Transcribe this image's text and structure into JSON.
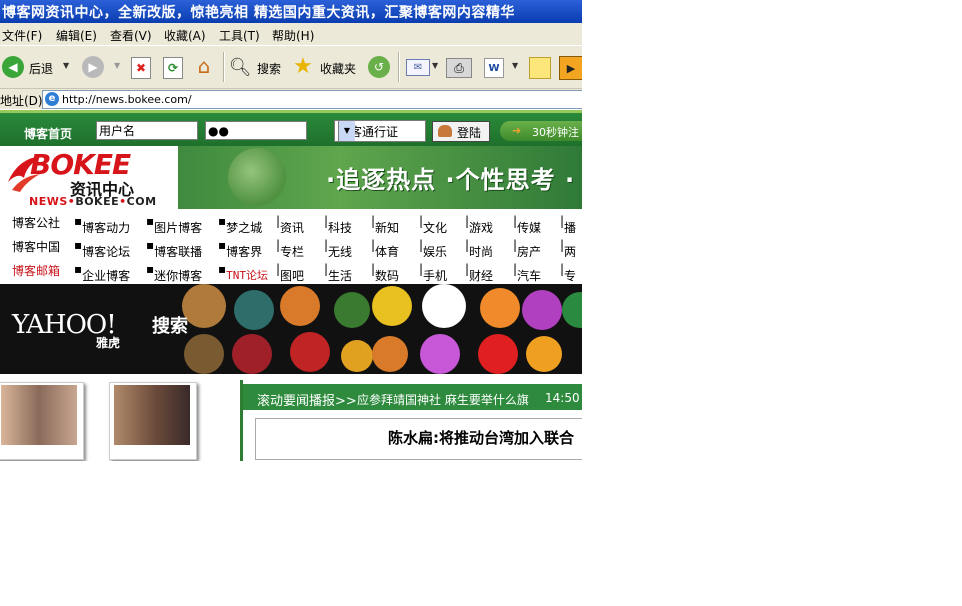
{
  "window": {
    "title": "博客网资讯中心，全新改版，惊艳亮相 精选国内重大资讯，汇聚博客网内容精华"
  },
  "menu": [
    "文件(F)",
    "编辑(E)",
    "查看(V)",
    "收藏(A)",
    "工具(T)",
    "帮助(H)"
  ],
  "toolbar": {
    "back": "后退",
    "search": "搜索",
    "favorites": "收藏夹"
  },
  "address": {
    "label": "地址(D)",
    "url": "http://news.bokee.com/"
  },
  "login": {
    "home": "博客首页",
    "username_value": "用户名",
    "password_value": "●●",
    "passport": "博客通行证",
    "login_button": "登陆",
    "promo": "30秒钟注"
  },
  "brand": {
    "logo": "BOKEE",
    "subtitle": "资讯中心",
    "news": "NEWS",
    "bokee": "BOKEE",
    "com": "COM",
    "slogan": "·追逐热点 ·个性思考 ·"
  },
  "nav": [
    [
      "博客公社",
      "博客动力",
      "图片博客",
      "梦之城",
      "资讯",
      "科技",
      "新知",
      "文化",
      "游戏",
      "传媒",
      "播"
    ],
    [
      "博客中国",
      "博客论坛",
      "博客联播",
      "博客界",
      "专栏",
      "无线",
      "体育",
      "娱乐",
      "时尚",
      "房产",
      "两"
    ],
    [
      "博客邮箱",
      "企业博客",
      "迷你博客",
      "TNT论坛",
      "图吧",
      "生活",
      "数码",
      "手机",
      "财经",
      "汽车",
      "专"
    ]
  ],
  "yahoo": {
    "logo": "YAHOO!",
    "search": "搜索",
    "cn": "雅虎"
  },
  "news": {
    "label": "滚动要闻播报>>",
    "ticker": "应参拜靖国神社 麻生要举什么旗",
    "time": "14:50",
    "headline": "陈水扁:将推动台湾加入联合"
  }
}
